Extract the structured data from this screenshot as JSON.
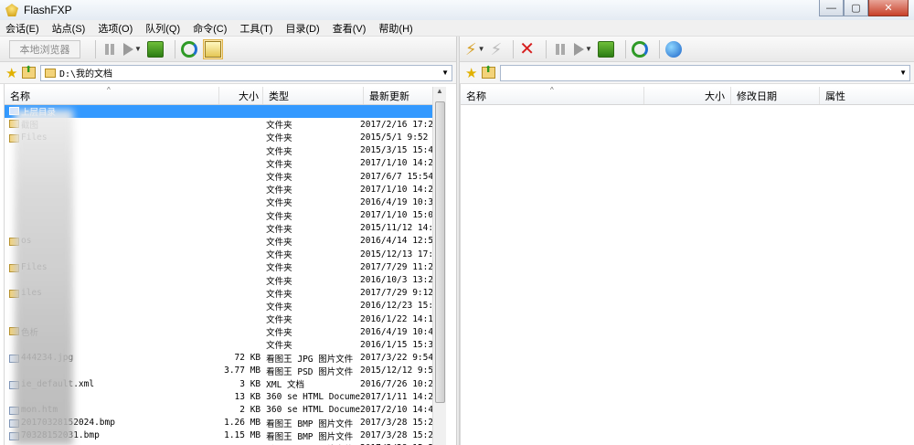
{
  "window": {
    "title": "FlashFXP",
    "minimize": "—",
    "maximize": "▢",
    "close": "✕"
  },
  "menu": [
    "会话(E)",
    "站点(S)",
    "选项(O)",
    "队列(Q)",
    "命令(C)",
    "工具(T)",
    "目录(D)",
    "查看(V)",
    "帮助(H)"
  ],
  "left_toolbar": {
    "local_browser_label": "本地浏览器"
  },
  "left_address": {
    "path": "D:\\我的文档"
  },
  "right_address": {
    "path": ""
  },
  "left_columns": {
    "name": "名称",
    "size": "大小",
    "type": "类型",
    "modified": "最新更新"
  },
  "right_columns": {
    "name": "名称",
    "size": "大小",
    "modified": "修改日期",
    "attributes": "属性"
  },
  "left_rows": [
    {
      "name": "上层目录",
      "size": "",
      "type": "",
      "date": "",
      "icon": "up",
      "selected": true
    },
    {
      "name": "截图",
      "size": "",
      "type": "文件夹",
      "date": "2017/2/16 17:28",
      "icon": "folder"
    },
    {
      "name": "Files",
      "size": "",
      "type": "文件夹",
      "date": "2015/5/1 9:52",
      "icon": "folder"
    },
    {
      "name": "",
      "size": "",
      "type": "文件夹",
      "date": "2015/3/15 15:48",
      "icon": "folder"
    },
    {
      "name": "",
      "size": "",
      "type": "文件夹",
      "date": "2017/1/10 14:24",
      "icon": "folder"
    },
    {
      "name": "",
      "size": "",
      "type": "文件夹",
      "date": "2017/6/7 15:54",
      "icon": "folder"
    },
    {
      "name": "",
      "size": "",
      "type": "文件夹",
      "date": "2017/1/10 14:27",
      "icon": "folder"
    },
    {
      "name": "",
      "size": "",
      "type": "文件夹",
      "date": "2016/4/19 10:39",
      "icon": "folder"
    },
    {
      "name": "",
      "size": "",
      "type": "文件夹",
      "date": "2017/1/10 15:00",
      "icon": "folder"
    },
    {
      "name": "",
      "size": "",
      "type": "文件夹",
      "date": "2015/11/12 14:16",
      "icon": "folder"
    },
    {
      "name": "os",
      "size": "",
      "type": "文件夹",
      "date": "2016/4/14 12:52",
      "icon": "folder"
    },
    {
      "name": "",
      "size": "",
      "type": "文件夹",
      "date": "2015/12/13 17:53",
      "icon": "folder"
    },
    {
      "name": "Files",
      "size": "",
      "type": "文件夹",
      "date": "2017/7/29 11:29",
      "icon": "folder"
    },
    {
      "name": "",
      "size": "",
      "type": "文件夹",
      "date": "2016/10/3 13:26",
      "icon": "folder"
    },
    {
      "name": "iles",
      "size": "",
      "type": "文件夹",
      "date": "2017/7/29 9:12",
      "icon": "folder"
    },
    {
      "name": "",
      "size": "",
      "type": "文件夹",
      "date": "2016/12/23 15:40",
      "icon": "folder"
    },
    {
      "name": "",
      "size": "",
      "type": "文件夹",
      "date": "2016/1/22 14:19",
      "icon": "folder"
    },
    {
      "name": "色析",
      "size": "",
      "type": "文件夹",
      "date": "2016/4/19 10:40",
      "icon": "folder"
    },
    {
      "name": "",
      "size": "",
      "type": "文件夹",
      "date": "2016/1/15 15:31",
      "icon": "folder"
    },
    {
      "name": "444234.jpg",
      "size": "72 KB",
      "type": "看图王 JPG 图片文件",
      "date": "2017/3/22 9:54",
      "icon": "file"
    },
    {
      "name": "",
      "size": "3.77 MB",
      "type": "看图王 PSD 图片文件",
      "date": "2015/12/12 9:54",
      "icon": "file"
    },
    {
      "name": "ie_default.xml",
      "size": "3 KB",
      "type": "XML 文档",
      "date": "2016/7/26 10:21",
      "icon": "file"
    },
    {
      "name": "",
      "size": "13 KB",
      "type": "360 se HTML Document",
      "date": "2017/1/11 14:23",
      "icon": "file"
    },
    {
      "name": "mon.htm",
      "size": "2 KB",
      "type": "360 se HTML Document",
      "date": "2017/2/10 14:44",
      "icon": "file"
    },
    {
      "name": "20170328152024.bmp",
      "size": "1.26 MB",
      "type": "看图王 BMP 图片文件",
      "date": "2017/3/28 15:20",
      "icon": "file"
    },
    {
      "name": "70328152031.bmp",
      "size": "1.15 MB",
      "type": "看图王 BMP 图片文件",
      "date": "2017/3/28 15:20",
      "icon": "file"
    },
    {
      "name": "",
      "size": "",
      "type": "看图王 BMP 图片文件",
      "date": "2017/3/28 15:20",
      "icon": "file"
    }
  ]
}
